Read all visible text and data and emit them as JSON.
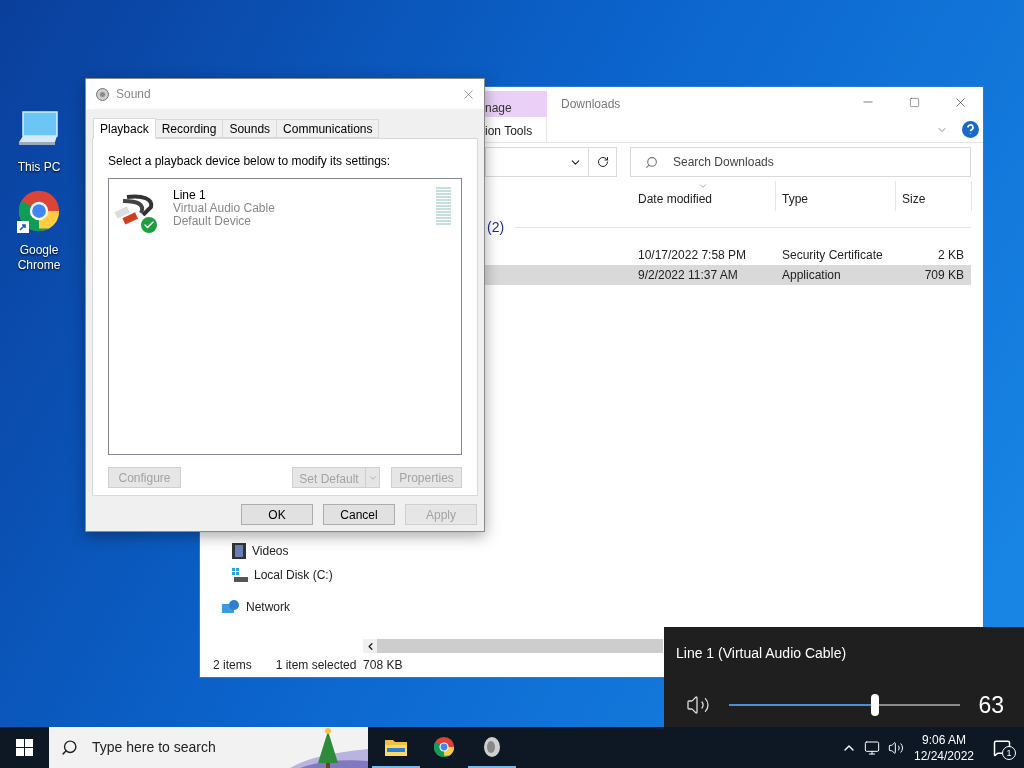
{
  "desktop_icons": [
    {
      "label": "This PC",
      "kind": "computer"
    },
    {
      "label": "Google Chrome",
      "kind": "chrome"
    }
  ],
  "explorer": {
    "context_band": "nage",
    "context_tab": "ion Tools",
    "title": "Downloads",
    "search": {
      "placeholder": "Search Downloads"
    },
    "columns": [
      "Date modified",
      "Type",
      "Size"
    ],
    "group": "(2)",
    "rows": [
      {
        "date": "10/17/2022 7:58 PM",
        "type": "Security Certificate",
        "size": "2 KB",
        "selected": false
      },
      {
        "date": "9/2/2022 11:37 AM",
        "type": "Application",
        "size": "709 KB",
        "selected": true
      }
    ],
    "nav": [
      {
        "label": "Videos",
        "kind": "videos"
      },
      {
        "label": "Local Disk (C:)",
        "kind": "disk"
      },
      {
        "label": "Network",
        "kind": "network"
      }
    ],
    "status": {
      "items": "2 items",
      "selection": "1 item selected  708 KB"
    }
  },
  "sound_dialog": {
    "title": "Sound",
    "tabs": [
      {
        "label": "Playback",
        "selected": true
      },
      {
        "label": "Recording",
        "selected": false
      },
      {
        "label": "Sounds",
        "selected": false
      },
      {
        "label": "Communications",
        "selected": false
      }
    ],
    "instruction": "Select a playback device below to modify its settings:",
    "devices": [
      {
        "name": "Line 1",
        "driver": "Virtual Audio Cable",
        "status": "Default Device",
        "default": true
      }
    ],
    "device_buttons": [
      {
        "label": "Configure",
        "disabled": true
      },
      {
        "label": "Set Default",
        "disabled": true
      },
      {
        "label": "Properties",
        "disabled": true
      }
    ],
    "buttons": [
      {
        "label": "OK",
        "disabled": false
      },
      {
        "label": "Cancel",
        "disabled": false
      },
      {
        "label": "Apply",
        "disabled": true
      }
    ]
  },
  "volume_flyout": {
    "device": "Line 1 (Virtual Audio Cable)",
    "level": 0.63,
    "reading": "63"
  },
  "taskbar": {
    "search": {
      "placeholder": "Type here to search"
    },
    "apps": [
      {
        "kind": "folder",
        "active": true
      },
      {
        "kind": "chrome",
        "active": false
      },
      {
        "kind": "sound",
        "active": true
      }
    ],
    "time": "9:06 AM",
    "date": "12/24/2022",
    "notifications": "1"
  }
}
